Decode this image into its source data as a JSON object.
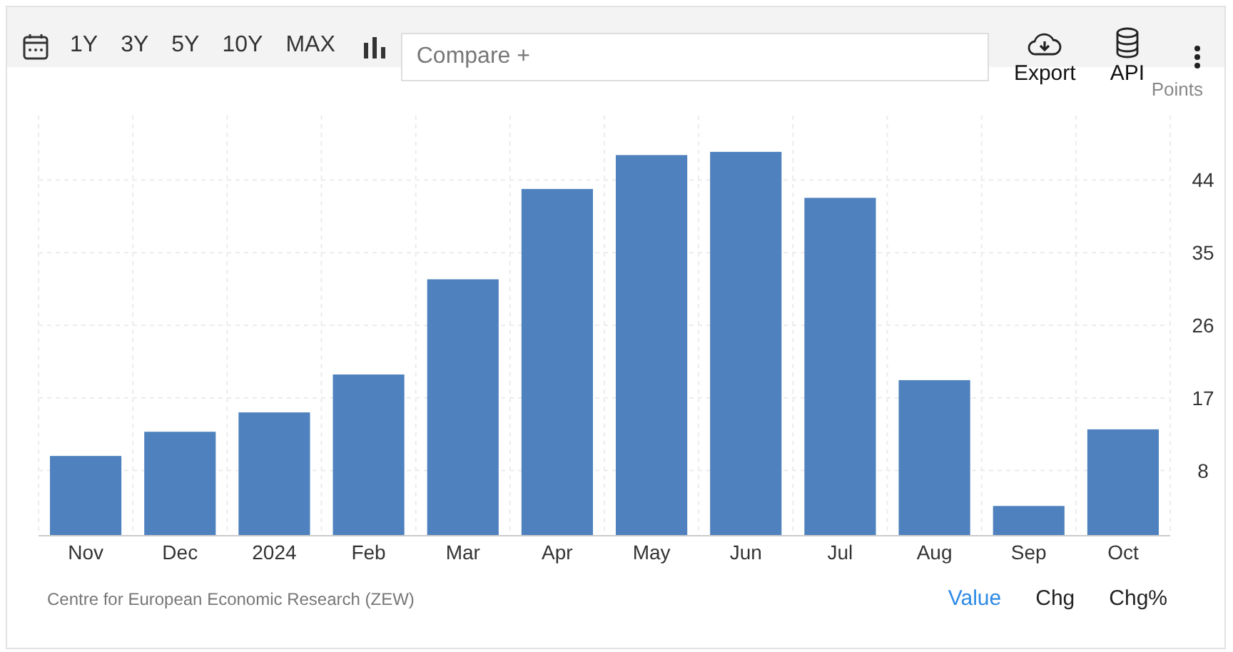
{
  "toolbar": {
    "ranges": [
      {
        "label": "1Y"
      },
      {
        "label": "3Y"
      },
      {
        "label": "5Y"
      },
      {
        "label": "10Y"
      },
      {
        "label": "MAX"
      }
    ],
    "compare": {
      "placeholder": "Compare +"
    },
    "actions": [
      {
        "label": "Export",
        "kind": "export"
      },
      {
        "label": "API",
        "kind": "api"
      }
    ]
  },
  "chart": {
    "chart_data": {
      "type": "bar",
      "ylabel": "Points",
      "categories": [
        "Nov",
        "Dec",
        "2024",
        "Feb",
        "Mar",
        "Apr",
        "May",
        "Jun",
        "Jul",
        "Aug",
        "Sep",
        "Oct"
      ],
      "grid": true,
      "series": [
        {
          "color": "#4e81bd",
          "values": [
            9.8,
            12.8,
            15.2,
            19.9,
            31.7,
            42.9,
            47.1,
            47.5,
            41.8,
            19.2,
            3.6,
            13.1
          ]
        }
      ],
      "ylim": [
        0,
        52
      ],
      "yticks": [
        8,
        17,
        26,
        35,
        44
      ]
    }
  },
  "footer": {
    "source": "Centre for European Economic Research (ZEW)",
    "views": [
      {
        "label": "Value",
        "selected": true
      },
      {
        "label": "Chg",
        "selected": false
      },
      {
        "label": "Chg%",
        "selected": false
      }
    ]
  }
}
